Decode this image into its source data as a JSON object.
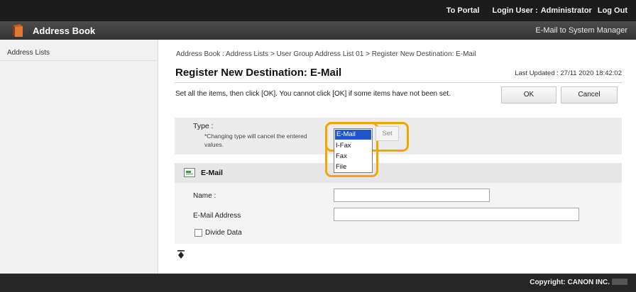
{
  "topbar": {
    "to_portal": "To Portal",
    "login_user_label": "Login User :",
    "login_user_value": "Administrator",
    "log_out": "Log Out"
  },
  "header": {
    "app_title": "Address Book",
    "system_manager": "E-Mail to System Manager"
  },
  "sidebar": {
    "items": [
      {
        "label": "Address Lists"
      }
    ]
  },
  "main": {
    "breadcrumb": "Address Book : Address Lists > User Group Address List 01 > Register New Destination: E-Mail",
    "title": "Register New Destination: E-Mail",
    "last_updated": "Last Updated : 27/11 2020 18:42:02",
    "instruction": "Set all the items, then click [OK]. You cannot click [OK] if some items have not been set.",
    "ok_label": "OK",
    "cancel_label": "Cancel",
    "type": {
      "label": "Type :",
      "note": "*Changing type will cancel the entered values.",
      "options": [
        "E-Mail",
        "I-Fax",
        "Fax",
        "File"
      ],
      "selected": "E-Mail",
      "set_label": "Set"
    },
    "email_section": {
      "title": "E-Mail",
      "name_label": "Name :",
      "name_value": "",
      "email_label": "E-Mail Address",
      "email_value": "",
      "divide_label": "Divide Data",
      "divide_checked": false
    }
  },
  "footer": {
    "copyright": "Copyright: CANON INC."
  },
  "colors": {
    "highlight": "#f0a700",
    "selected_option": "#1f56c8",
    "brand_icon": "#c25a1b"
  }
}
